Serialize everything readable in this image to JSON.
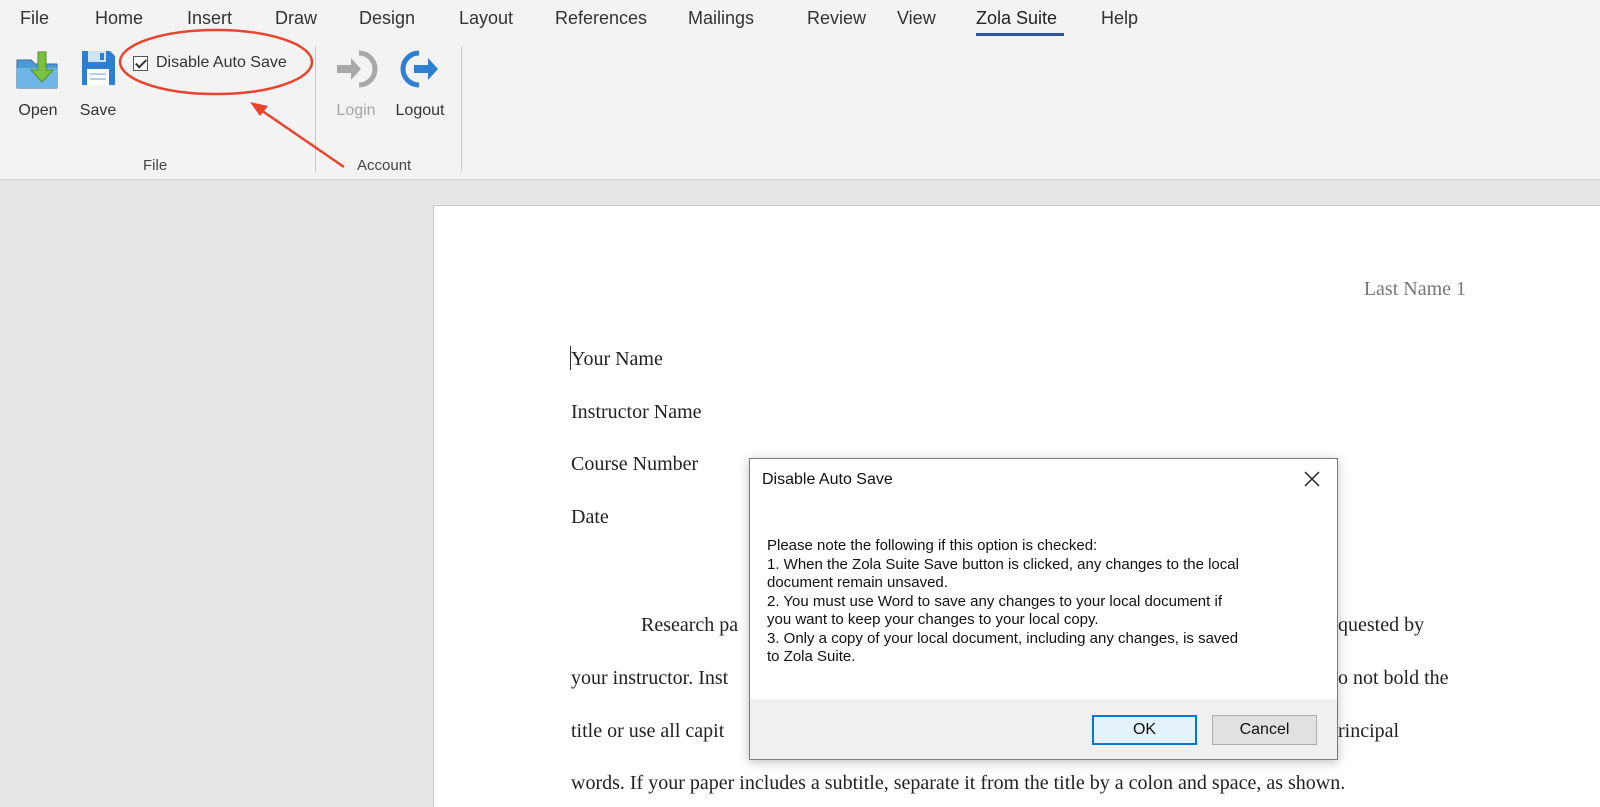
{
  "tabs": {
    "items": [
      "File",
      "Home",
      "Insert",
      "Draw",
      "Design",
      "Layout",
      "References",
      "Mailings",
      "Review",
      "View",
      "Zola Suite",
      "Help"
    ],
    "active": "Zola Suite"
  },
  "ribbon": {
    "file_group": {
      "label": "File",
      "open_label": "Open",
      "save_label": "Save",
      "disable_autosave_label": "Disable Auto Save",
      "disable_autosave_checked": true
    },
    "account_group": {
      "label": "Account",
      "login_label": "Login",
      "login_enabled": false,
      "logout_label": "Logout"
    }
  },
  "document": {
    "header": "Last Name 1",
    "lines": [
      "Your Name",
      "Instructor Name",
      "Course Number",
      "Date"
    ],
    "body": [
      {
        "left": "Research pa",
        "right": "quested by"
      },
      {
        "left": "your instructor. Inst",
        "right": "o not bold the"
      },
      {
        "left": "title or use all capit",
        "right": "rincipal"
      },
      {
        "left": "words. If your paper includes a subtitle, separate it from the title by a colon and space, as shown.",
        "right": ""
      }
    ]
  },
  "dialog": {
    "title": "Disable Auto Save",
    "message_lines": [
      "Please note the following if this option is checked:",
      "1. When the Zola Suite Save button is clicked, any changes to the local",
      "document remain unsaved.",
      "2. You must use Word to save any changes to your local document if",
      "you want to keep your changes to your local copy.",
      "3. Only a copy of your local document, including any changes, is saved",
      "to Zola Suite."
    ],
    "ok_label": "OK",
    "cancel_label": "Cancel"
  },
  "colors": {
    "accent": "#2b579a",
    "annotation": "#e8442e",
    "ok_border": "#0078d7"
  }
}
